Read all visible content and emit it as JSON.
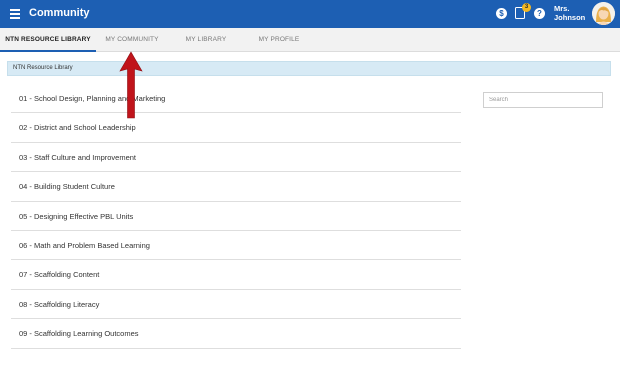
{
  "header": {
    "title": "Community",
    "notification_count": "3",
    "user_name_line1": "Mrs.",
    "user_name_line2": "Johnson",
    "dollar_glyph": "$",
    "help_glyph": "?"
  },
  "tabs": [
    {
      "label": "NTN RESOURCE LIBRARY",
      "active": true
    },
    {
      "label": "MY COMMUNITY",
      "active": false
    },
    {
      "label": "MY LIBRARY",
      "active": false
    },
    {
      "label": "MY PROFILE",
      "active": false
    }
  ],
  "breadcrumb": "NTN Resource Library",
  "search": {
    "placeholder": "Search",
    "value": ""
  },
  "library_items": [
    "01 - School Design, Planning and Marketing",
    "02 - District and School Leadership",
    "03 - Staff Culture and Improvement",
    "04 - Building Student Culture",
    "05 - Designing Effective PBL Units",
    "06 - Math and Problem Based Learning",
    "07 - Scaffolding Content",
    "08 - Scaffolding Literacy",
    "09 - Scaffolding Learning Outcomes"
  ],
  "colors": {
    "header_blue": "#1d5fb3",
    "tab_bar": "#f2f2f2",
    "breadcrumb_bg": "#d7eaf5",
    "badge_yellow": "#f5b921",
    "annotation_arrow": "#c0141b"
  },
  "icons": [
    "hamburger-menu-icon",
    "dollar-icon",
    "notes-icon",
    "help-icon"
  ]
}
